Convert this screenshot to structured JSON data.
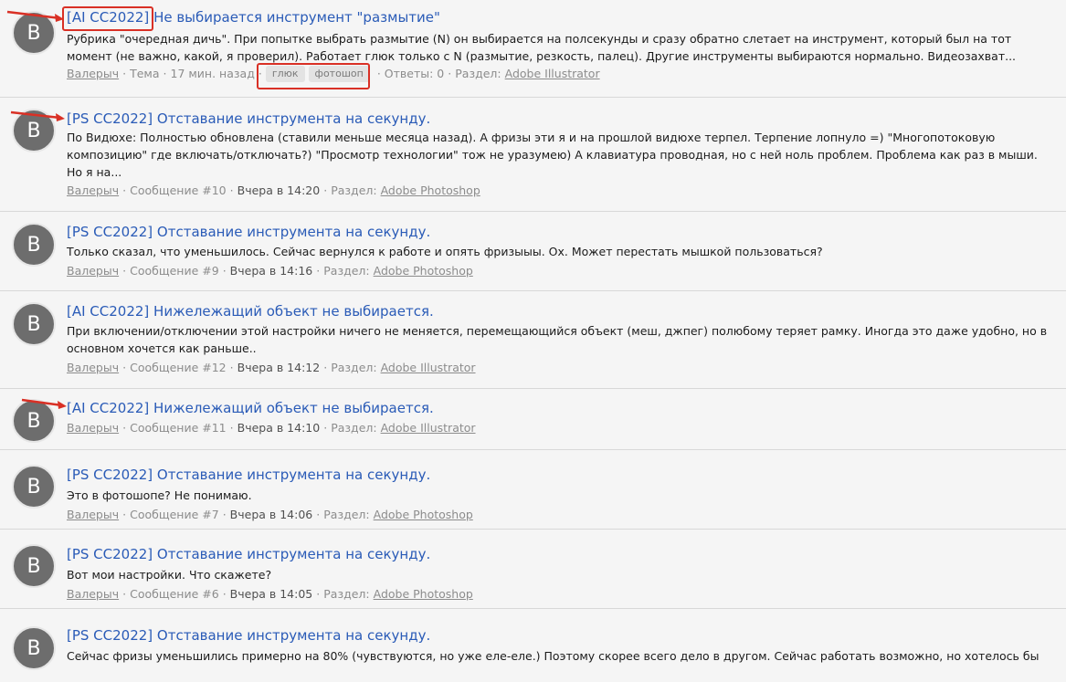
{
  "results": [
    {
      "avatar": "B",
      "title_prefix": "[AI CC2022]",
      "title_rest": "Не выбирается инструмент \"размытие\"",
      "snippet": "Рубрика \"очередная дичь\". При попытке выбрать размытие (N) он выбирается на полсекунды и сразу обратно слетает на инструмент, который был на тот момент (не важно, какой, я проверил). Работает глюк только с N (размытие, резкость, палец). Другие инструменты выбираются нормально. Видеозахват...",
      "author": "Валерыч",
      "type": "Тема",
      "time": "17 мин. назад",
      "tags": [
        "глюк",
        "фотошоп"
      ],
      "replies": "Ответы: 0",
      "section_label": "Раздел:",
      "section": "Adobe Illustrator"
    },
    {
      "avatar": "B",
      "title": "[PS CC2022] Отставание инструмента на секунду.",
      "snippet": "По Видюхе: Полностью обновлена (ставили меньше месяца назад). А фризы эти я и на прошлой видюхе терпел. Терпение лопнуло =) \"Многопотоковую композицию\" где включать/отключать?) \"Просмотр технологии\" тож не уразумею) А клавиатура проводная, но с ней ноль проблем. Проблема как раз в мыши. Но я на...",
      "author": "Валерыч",
      "message": "Сообщение #10",
      "time": "Вчера в 14:20",
      "section_label": "Раздел:",
      "section": "Adobe Photoshop"
    },
    {
      "avatar": "B",
      "title": "[PS CC2022] Отставание инструмента на секунду.",
      "snippet": "Только сказал, что уменьшилось. Сейчас вернулся к работе и опять фризыыы. Ох. Может перестать мышкой пользоваться?",
      "author": "Валерыч",
      "message": "Сообщение #9",
      "time": "Вчера в 14:16",
      "section_label": "Раздел:",
      "section": "Adobe Photoshop"
    },
    {
      "avatar": "B",
      "title": "[AI CC2022] Нижележащий объект не выбирается.",
      "snippet": "При включении/отключении этой настройки ничего не меняется, перемещающийся объект (меш, джпег) полюбому теряет рамку. Иногда это даже удобно, но в основном хочется как раньше..",
      "author": "Валерыч",
      "message": "Сообщение #12",
      "time": "Вчера в 14:12",
      "section_label": "Раздел:",
      "section": "Adobe Illustrator"
    },
    {
      "avatar": "B",
      "title": "[AI CC2022] Нижележащий объект не выбирается.",
      "snippet": "",
      "author": "Валерыч",
      "message": "Сообщение #11",
      "time": "Вчера в 14:10",
      "section_label": "Раздел:",
      "section": "Adobe Illustrator"
    },
    {
      "avatar": "B",
      "title": "[PS CC2022] Отставание инструмента на секунду.",
      "snippet": "Это в фотошопе? Не понимаю.",
      "author": "Валерыч",
      "message": "Сообщение #7",
      "time": "Вчера в 14:06",
      "section_label": "Раздел:",
      "section": "Adobe Photoshop"
    },
    {
      "avatar": "B",
      "title": "[PS CC2022] Отставание инструмента на секунду.",
      "snippet": "Вот мои настройки. Что скажете?",
      "author": "Валерыч",
      "message": "Сообщение #6",
      "time": "Вчера в 14:05",
      "section_label": "Раздел:",
      "section": "Adobe Photoshop"
    },
    {
      "avatar": "B",
      "title": "[PS CC2022] Отставание инструмента на секунду.",
      "snippet": "Сейчас фризы уменьшились примерно на 80% (чувствуются, но уже еле-еле.) Поэтому скорее всего дело в другом. Сейчас работать возможно, но хотелось бы",
      "author": "",
      "message": "",
      "time": "",
      "section_label": "",
      "section": ""
    }
  ]
}
